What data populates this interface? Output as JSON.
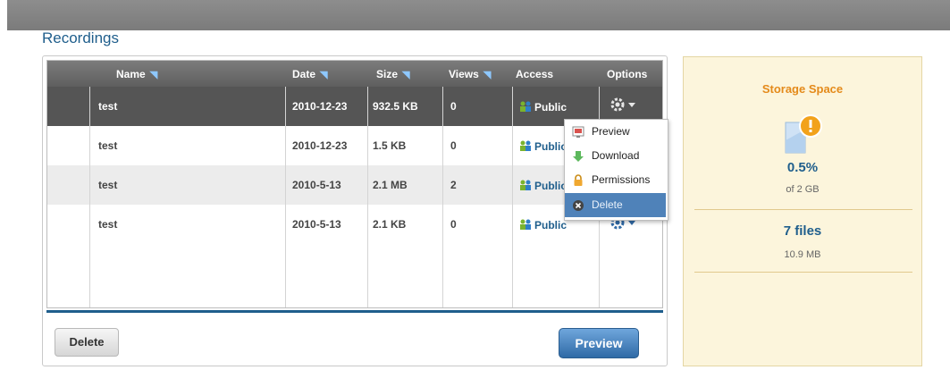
{
  "page": {
    "title": "Recordings"
  },
  "table": {
    "columns": {
      "name": "Name",
      "date": "Date",
      "size": "Size",
      "views": "Views",
      "access": "Access",
      "options": "Options"
    },
    "rows": [
      {
        "name": "test",
        "date": "2010-12-23",
        "size": "932.5 KB",
        "views": "0",
        "access": "Public",
        "selected": true
      },
      {
        "name": "test",
        "date": "2010-12-23",
        "size": "1.5 KB",
        "views": "0",
        "access": "Public"
      },
      {
        "name": "test",
        "date": "2010-5-13",
        "size": "2.1 MB",
        "views": "2",
        "access": "Public"
      },
      {
        "name": "test",
        "date": "2010-5-13",
        "size": "2.1 KB",
        "views": "0",
        "access": "Public"
      }
    ]
  },
  "menu": {
    "items": {
      "preview": "Preview",
      "download": "Download",
      "permissions": "Permissions",
      "delete": "Delete"
    },
    "hovered": "delete"
  },
  "buttons": {
    "delete": "Delete",
    "preview": "Preview"
  },
  "storage": {
    "title": "Storage Space",
    "percent": "0.5%",
    "of_total": "of 2 GB",
    "files": "7 files",
    "files_size": "10.9 MB"
  },
  "colors": {
    "accent": "#1f5e8c",
    "storage_title": "#e48a1a",
    "selection": "#555555",
    "menu_hover": "#4f82b9"
  }
}
